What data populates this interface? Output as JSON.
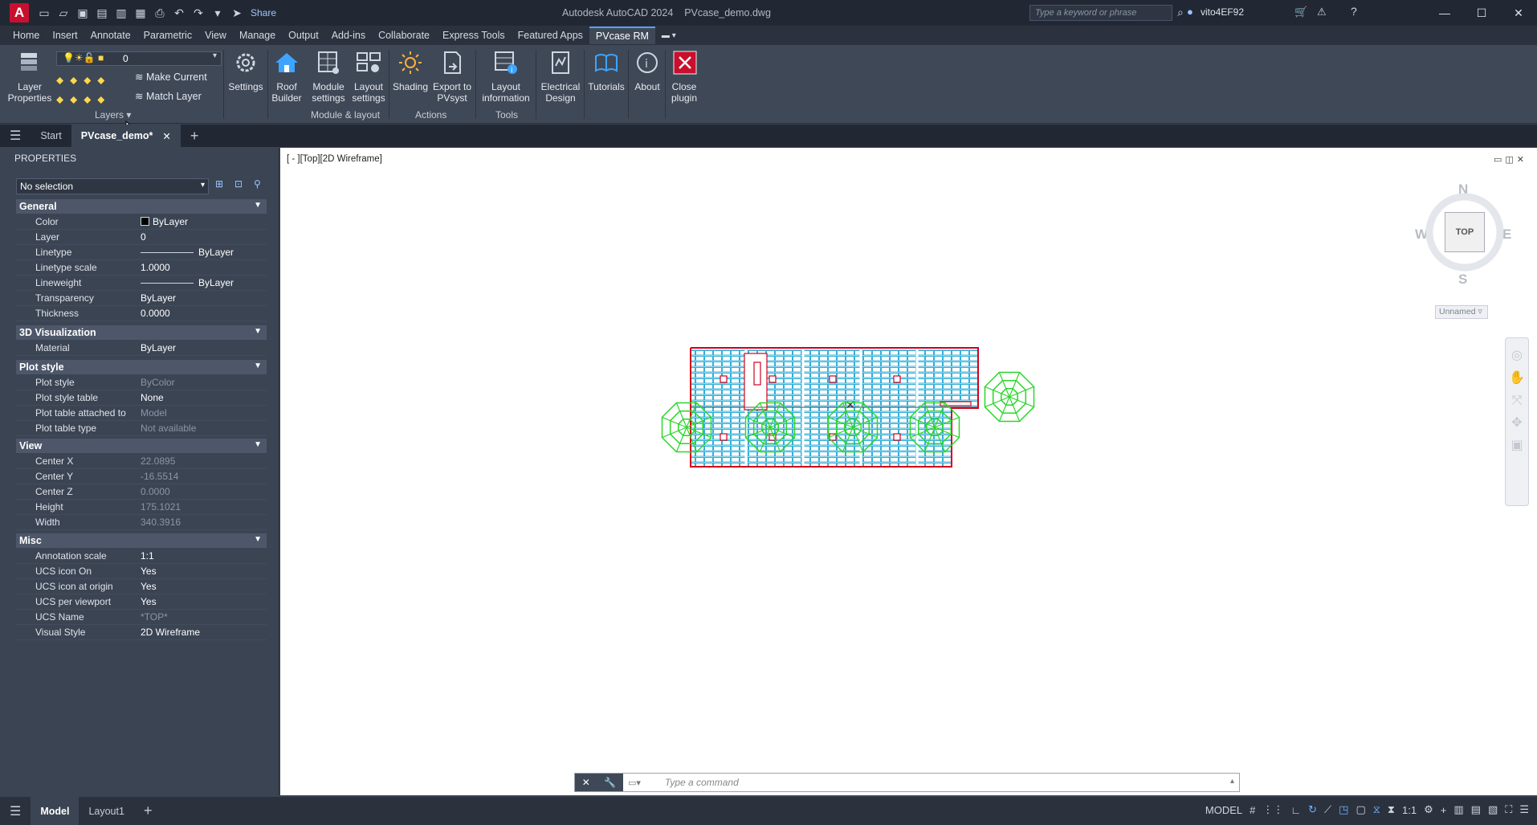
{
  "titlebar": {
    "app_title": "Autodesk AutoCAD 2024",
    "file_name": "PVcase_demo.dwg",
    "share_label": "Share",
    "search_placeholder": "Type a keyword or phrase",
    "user_name": "vito4EF92"
  },
  "ribbon_tabs": [
    "Home",
    "Insert",
    "Annotate",
    "Parametric",
    "View",
    "Manage",
    "Output",
    "Add-ins",
    "Collaborate",
    "Express Tools",
    "Featured Apps",
    "PVcase RM"
  ],
  "active_ribbon_tab": "PVcase RM",
  "ribbon": {
    "layer_properties_line1": "Layer",
    "layer_properties_line2": "Properties",
    "layer_value": "0",
    "make_current": "Make Current",
    "match_layer": "Match Layer",
    "layers_group": "Layers",
    "settings": "Settings",
    "roof_builder_line1": "Roof",
    "roof_builder_line2": "Builder",
    "module_settings_line1": "Module",
    "module_settings_line2": "settings",
    "layout_settings_line1": "Layout",
    "layout_settings_line2": "settings",
    "module_layout_group": "Module & layout",
    "shading": "Shading",
    "export_line1": "Export to",
    "export_line2": "PVsyst",
    "actions_group": "Actions",
    "layout_info_line1": "Layout",
    "layout_info_line2": "information",
    "tools_group": "Tools",
    "electrical_line1": "Electrical",
    "electrical_line2": "Design",
    "tutorials": "Tutorials",
    "about": "About",
    "close_line1": "Close",
    "close_line2": "plugin"
  },
  "doc_tabs": {
    "start": "Start",
    "active": "PVcase_demo*"
  },
  "properties": {
    "title": "PROPERTIES",
    "selection": "No selection",
    "general": {
      "title": "General",
      "color_k": "Color",
      "color_v": "ByLayer",
      "layer_k": "Layer",
      "layer_v": "0",
      "linetype_k": "Linetype",
      "linetype_v": "ByLayer",
      "ltscale_k": "Linetype scale",
      "ltscale_v": "1.0000",
      "lineweight_k": "Lineweight",
      "lineweight_v": "ByLayer",
      "transparency_k": "Transparency",
      "transparency_v": "ByLayer",
      "thickness_k": "Thickness",
      "thickness_v": "0.0000"
    },
    "viz3d": {
      "title": "3D Visualization",
      "material_k": "Material",
      "material_v": "ByLayer"
    },
    "plot": {
      "title": "Plot style",
      "style_k": "Plot style",
      "style_v": "ByColor",
      "table_k": "Plot style table",
      "table_v": "None",
      "attached_k": "Plot table attached to",
      "attached_v": "Model",
      "type_k": "Plot table type",
      "type_v": "Not available"
    },
    "view": {
      "title": "View",
      "cx_k": "Center X",
      "cx_v": "22.0895",
      "cy_k": "Center Y",
      "cy_v": "-16.5514",
      "cz_k": "Center Z",
      "cz_v": "0.0000",
      "h_k": "Height",
      "h_v": "175.1021",
      "w_k": "Width",
      "w_v": "340.3916"
    },
    "misc": {
      "title": "Misc",
      "ann_k": "Annotation scale",
      "ann_v": "1:1",
      "ucson_k": "UCS icon On",
      "ucson_v": "Yes",
      "ucsorig_k": "UCS icon at origin",
      "ucsorig_v": "Yes",
      "ucsvp_k": "UCS per viewport",
      "ucsvp_v": "Yes",
      "ucsname_k": "UCS Name",
      "ucsname_v": "*TOP*",
      "vstyle_k": "Visual Style",
      "vstyle_v": "2D Wireframe"
    }
  },
  "viewport": {
    "label": "[ - ][Top][2D Wireframe]",
    "cube_face": "TOP",
    "north": "N",
    "south": "S",
    "east": "E",
    "west": "W",
    "ucs_name": "Unnamed"
  },
  "command": {
    "placeholder": "Type a command"
  },
  "statusbar": {
    "model_tab": "Model",
    "layout_tab": "Layout1",
    "model_label": "MODEL",
    "scale": "1:1"
  },
  "colors": {
    "drawing_outline": "#d1001c",
    "panels": "#1fa6d6",
    "trees": "#2bd62b"
  }
}
